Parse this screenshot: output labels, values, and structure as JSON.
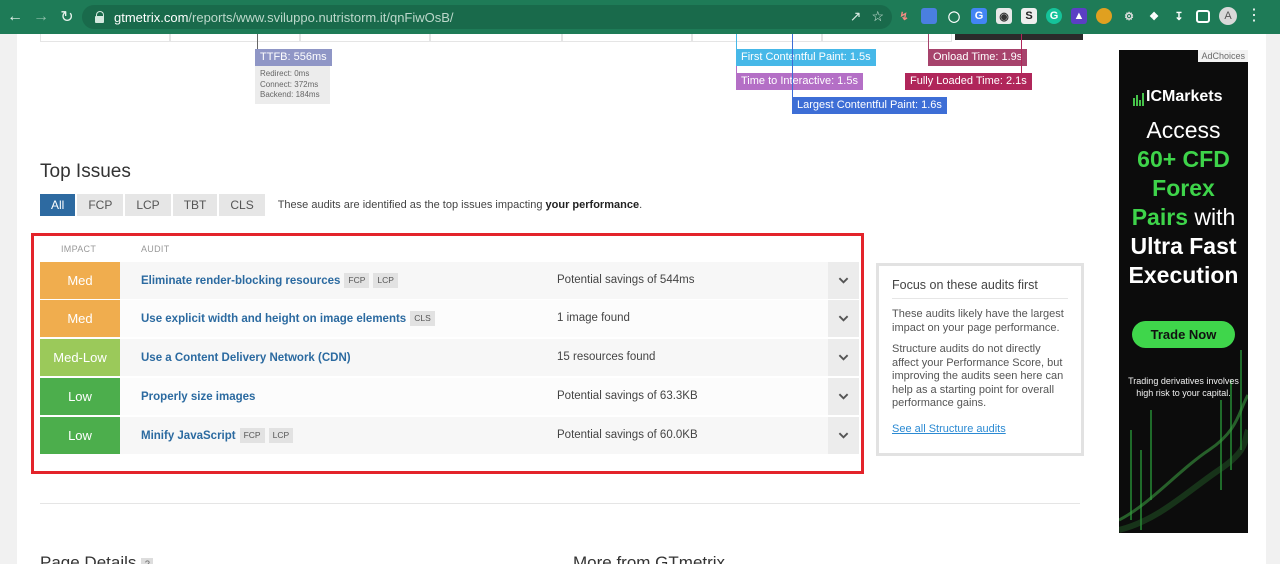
{
  "browser": {
    "url_host": "gtmetrix.com",
    "url_path": "/reports/www.sviluppo.nutristorm.it/qnFiwOsB/",
    "profile_initial": "A",
    "colors": {
      "chrome": "#1e7b57"
    }
  },
  "waterfall": {
    "ttfb": "TTFB: 556ms",
    "ttfb_breakdown": [
      "Redirect: 0ms",
      "Connect: 372ms",
      "Backend: 184ms"
    ],
    "fcp": "First Contentful Paint: 1.5s",
    "tti": "Time to Interactive: 1.5s",
    "lcp": "Largest Contentful Paint: 1.6s",
    "onload": "Onload Time: 1.9s",
    "fully_loaded": "Fully Loaded Time: 2.1s"
  },
  "top_issues": {
    "title": "Top Issues",
    "filters": [
      "All",
      "FCP",
      "LCP",
      "TBT",
      "CLS"
    ],
    "active_filter": "All",
    "note_prefix": "These audits are identified as the top issues impacting ",
    "note_bold": "your performance",
    "note_suffix": ".",
    "col_impact": "IMPACT",
    "col_audit": "AUDIT",
    "issues": [
      {
        "impact": "Med",
        "color": "#f0ad4e",
        "name": "Eliminate render-blocking resources",
        "chips": [
          "FCP",
          "LCP"
        ],
        "savings": "Potential savings of 544ms"
      },
      {
        "impact": "Med",
        "color": "#f0ad4e",
        "name": "Use explicit width and height on image elements",
        "chips": [
          "CLS"
        ],
        "savings": "1 image found"
      },
      {
        "impact": "Med-Low",
        "color": "#9bc95a",
        "name": "Use a Content Delivery Network (CDN)",
        "chips": [],
        "savings": "15 resources found"
      },
      {
        "impact": "Low",
        "color": "#4cae4c",
        "name": "Properly size images",
        "chips": [],
        "savings": "Potential savings of 63.3KB"
      },
      {
        "impact": "Low",
        "color": "#4cae4c",
        "name": "Minify JavaScript",
        "chips": [
          "FCP",
          "LCP"
        ],
        "savings": "Potential savings of 60.0KB"
      }
    ]
  },
  "focus": {
    "title": "Focus on these audits first",
    "p1": "These audits likely have the largest impact on your page performance.",
    "p2": "Structure audits do not directly affect your Performance Score, but improving the audits seen here can help as a starting point for overall performance gains.",
    "link": "See all Structure audits"
  },
  "footer": {
    "page_details": "Page Details",
    "more_from": "More from GTmetrix"
  },
  "ad": {
    "choices": "AdChoices",
    "brand": "ICMarkets",
    "line1": "Access",
    "line2": "60+ CFD",
    "line3": "Forex",
    "line4a": "Pairs",
    "line4b": " with",
    "line5": "Ultra Fast",
    "line6": "Execution",
    "cta": "Trade Now",
    "risk": "Trading derivatives involves high risk to your capital."
  }
}
